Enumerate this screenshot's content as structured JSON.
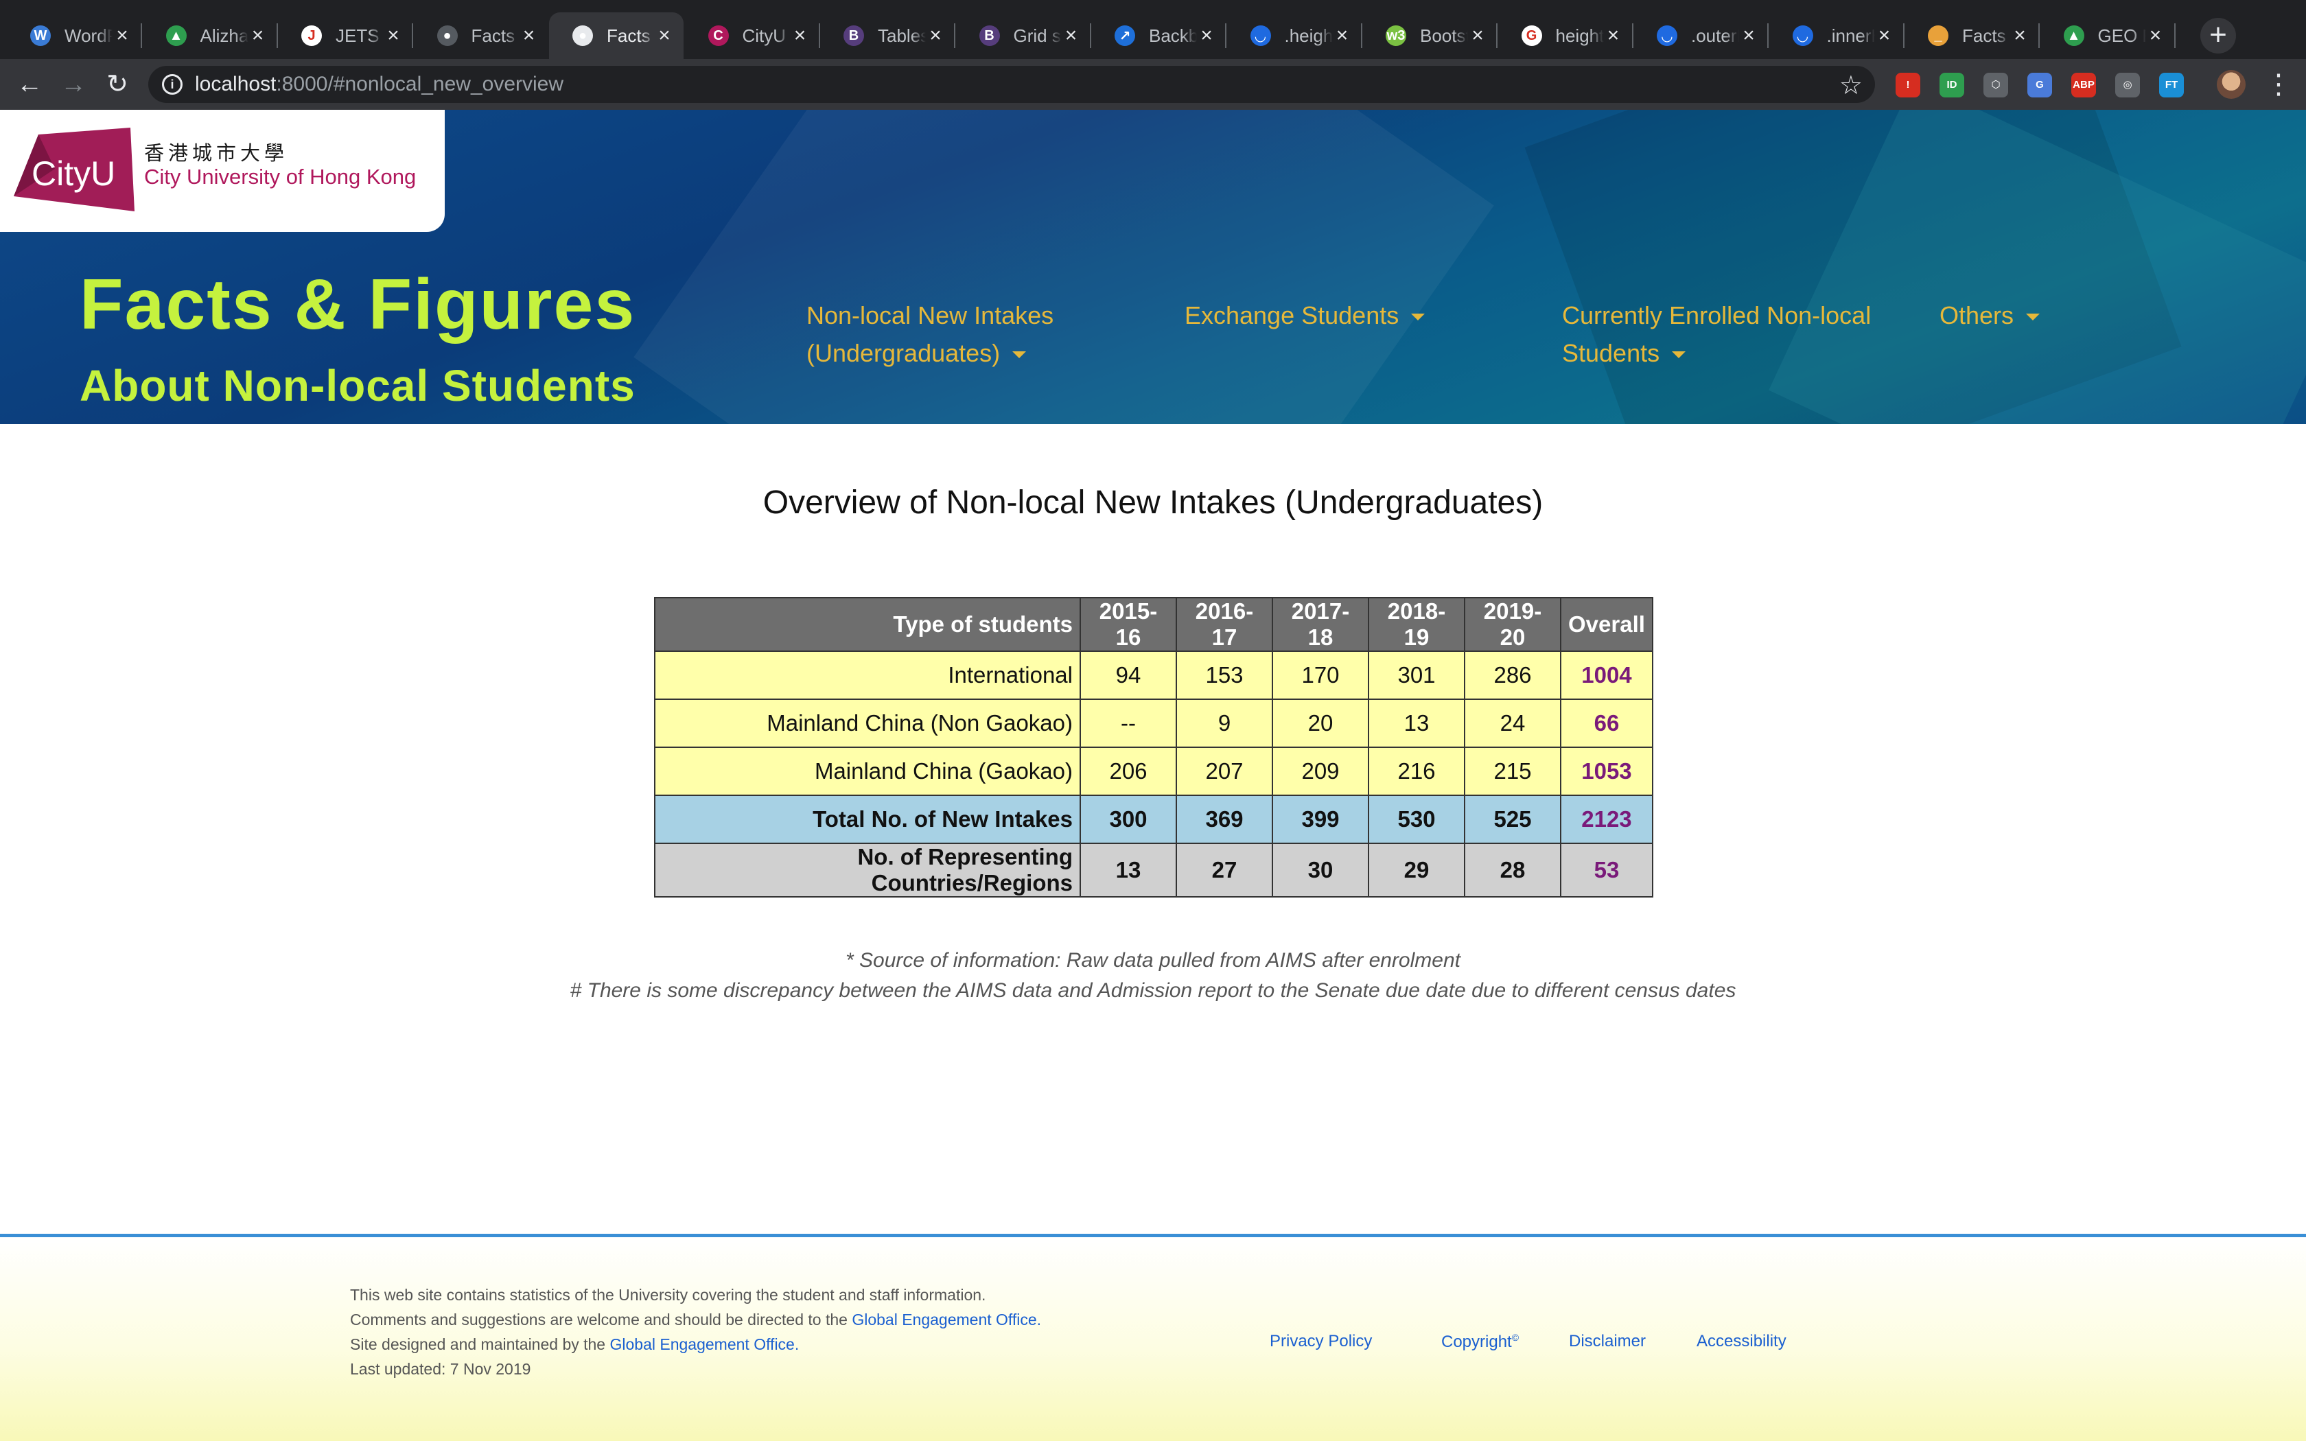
{
  "browser": {
    "tabs": [
      {
        "title": "WordPress",
        "fav_color": "#3a7bd5",
        "fav_glyph": "W"
      },
      {
        "title": "Alizhan",
        "fav_color": "#2e9e4f",
        "fav_glyph": "▲"
      },
      {
        "title": "JETS",
        "fav_color": "#ffffff",
        "fav_glyph": "J"
      },
      {
        "title": "Facts & Figures",
        "fav_color": "#555a60",
        "fav_glyph": "●"
      },
      {
        "title": "Facts & Figures",
        "fav_color": "#e8eaed",
        "fav_glyph": "●"
      },
      {
        "title": "CityU",
        "fav_color": "#b0185c",
        "fav_glyph": "C"
      },
      {
        "title": "Tables",
        "fav_color": "#563d7c",
        "fav_glyph": "B"
      },
      {
        "title": "Grid system",
        "fav_color": "#563d7c",
        "fav_glyph": "B"
      },
      {
        "title": "Backbone",
        "fav_color": "#1e6fd9",
        "fav_glyph": "↗"
      },
      {
        "title": ".height()",
        "fav_color": "#1f6ae0",
        "fav_glyph": "◡"
      },
      {
        "title": "Bootstrap",
        "fav_color": "#7bc142",
        "fav_glyph": "w3"
      },
      {
        "title": "height",
        "fav_color": "#ffffff",
        "fav_glyph": "G"
      },
      {
        "title": ".outerHeight()",
        "fav_color": "#1f6ae0",
        "fav_glyph": "◡"
      },
      {
        "title": ".innerHeight()",
        "fav_color": "#1f6ae0",
        "fav_glyph": "◡"
      },
      {
        "title": "Facts & Figures",
        "fav_color": "#e8a13a",
        "fav_glyph": "_"
      },
      {
        "title": "GEO Facts",
        "fav_color": "#2e9e4f",
        "fav_glyph": "▲"
      }
    ],
    "url_host": "localhost",
    "url_rest": ":8000/#nonlocal_new_overview",
    "extensions": [
      {
        "label": "!",
        "color": "#d62d20"
      },
      {
        "label": "ID",
        "color": "#2e9e4f"
      },
      {
        "label": "⬡",
        "color": "#5f6368"
      },
      {
        "label": "G",
        "color": "#4a7bd9"
      },
      {
        "label": "ABP",
        "color": "#d62d20"
      },
      {
        "label": "◎",
        "color": "#5f6368"
      },
      {
        "label": "FT",
        "color": "#1a8fd6"
      }
    ]
  },
  "header": {
    "logo_wordmark": "CityU",
    "logo_chinese": "香港城市大學",
    "logo_english": "City University of Hong Kong",
    "title": "Facts & Figures",
    "subtitle": "About Non-local Students",
    "nav": [
      {
        "line1": "Non-local New Intakes",
        "line2": "(Undergraduates)"
      },
      {
        "line1": "Exchange Students",
        "line2": ""
      },
      {
        "line1": "Currently Enrolled Non-local",
        "line2": "Students"
      },
      {
        "line1": "Others",
        "line2": ""
      }
    ]
  },
  "main": {
    "title": "Overview of Non-local New Intakes (Undergraduates)",
    "table": {
      "headers": [
        "Type of students",
        "2015-16",
        "2016-17",
        "2017-18",
        "2018-19",
        "2019-20",
        "Overall"
      ],
      "rows": [
        {
          "style": "yellow",
          "cells": [
            "International",
            "94",
            "153",
            "170",
            "301",
            "286",
            "1004"
          ]
        },
        {
          "style": "yellow",
          "cells": [
            "Mainland China (Non Gaokao)",
            "--",
            "9",
            "20",
            "13",
            "24",
            "66"
          ]
        },
        {
          "style": "yellow",
          "cells": [
            "Mainland China (Gaokao)",
            "206",
            "207",
            "209",
            "216",
            "215",
            "1053"
          ]
        },
        {
          "style": "blue",
          "cells": [
            "Total No. of New Intakes",
            "300",
            "369",
            "399",
            "530",
            "525",
            "2123"
          ]
        },
        {
          "style": "grey",
          "cells": [
            "No. of Representing Countries/Regions",
            "13",
            "27",
            "30",
            "29",
            "28",
            "53"
          ]
        }
      ]
    },
    "note1": "* Source of information: Raw data pulled from AIMS after enrolment",
    "note2": "# There is some discrepancy between the AIMS data and Admission report to the Senate due date due to different census dates"
  },
  "footer": {
    "line1": "This web site contains statistics of the University covering the student and staff information.",
    "line2_prefix": "Comments and suggestions are welcome and should be directed to the ",
    "line2_link": "Global Engagement Office.",
    "line3_prefix": "Site designed and maintained by the ",
    "line3_link": "Global Engagement Office.",
    "line4": "Last updated: 7 Nov 2019",
    "links": {
      "privacy": "Privacy Policy",
      "copyright": "Copyright",
      "copyright_sup": "©",
      "disclaimer": "Disclaimer",
      "accessibility": "Accessibility"
    }
  }
}
